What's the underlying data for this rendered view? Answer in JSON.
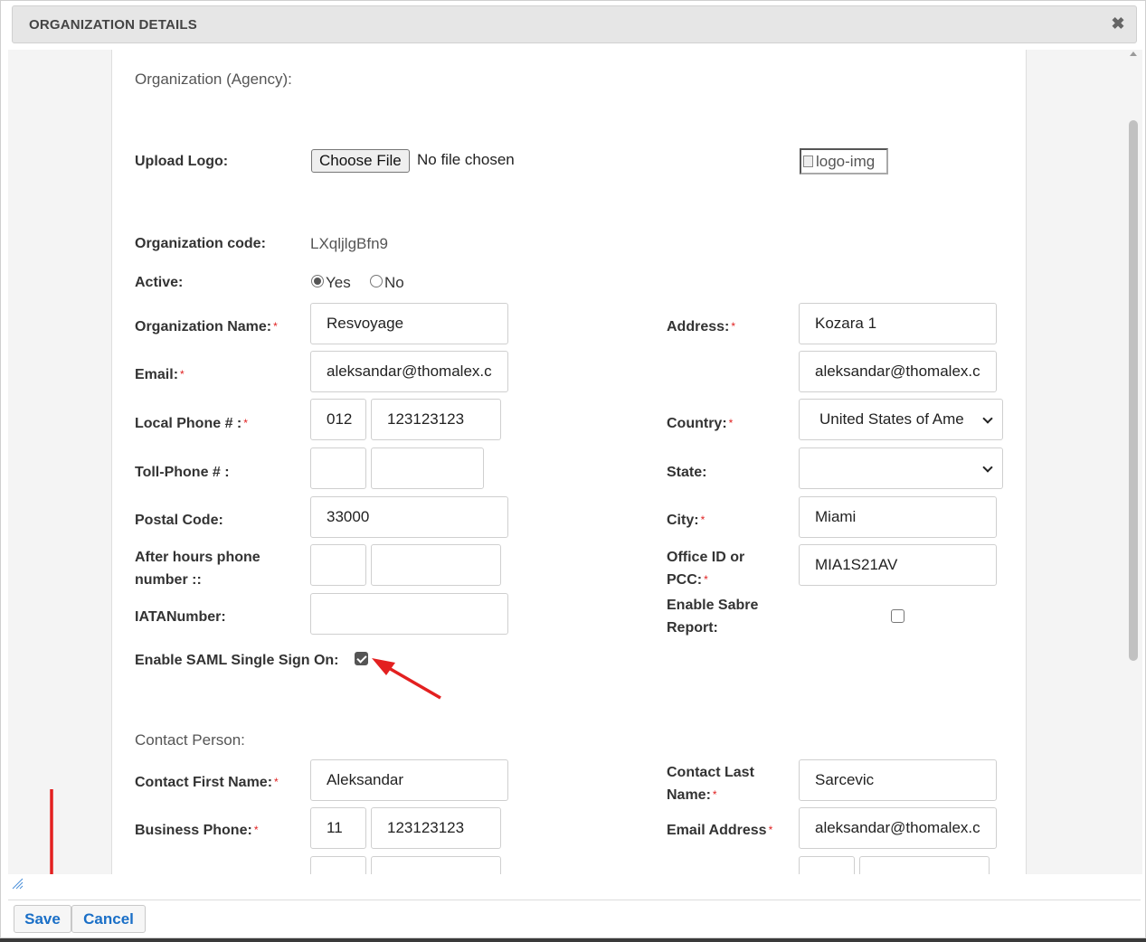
{
  "dialog": {
    "title": "ORGANIZATION DETAILS",
    "close_glyph": "✖"
  },
  "sections": {
    "organization": "Organization (Agency):",
    "contact": "Contact Person:"
  },
  "upload_logo": {
    "label": "Upload Logo:",
    "button": "Choose File",
    "status": "No file chosen",
    "logo_alt": "logo-img"
  },
  "org_code": {
    "label": "Organization code:",
    "value": "LXqljlgBfn9"
  },
  "active": {
    "label": "Active:",
    "yes": "Yes",
    "no": "No",
    "selected": "Yes"
  },
  "left_fields": {
    "org_name": {
      "label": "Organization Name:",
      "required": "*",
      "value": "Resvoyage"
    },
    "email": {
      "label": "Email:",
      "required": "*",
      "value": "aleksandar@thomalex.c"
    },
    "local_phone": {
      "label": "Local Phone # :",
      "required": "*",
      "code": "012",
      "number": "123123123"
    },
    "toll_phone": {
      "label": "Toll-Phone # :",
      "code": "",
      "number": ""
    },
    "postal_code": {
      "label": "Postal Code:",
      "value": "33000"
    },
    "after_hours": {
      "label_line1": "After hours phone",
      "label_line2": "number ::",
      "code": "",
      "number": ""
    },
    "iata": {
      "label": "IATANumber:",
      "value": ""
    },
    "saml": {
      "label": "Enable SAML Single Sign On:",
      "checked": true
    }
  },
  "right_fields": {
    "address": {
      "label": "Address:",
      "required": "*",
      "line1": "Kozara 1",
      "line2": "aleksandar@thomalex.c"
    },
    "country": {
      "label": "Country:",
      "required": "*",
      "value": "United States of Ame"
    },
    "state": {
      "label": "State:",
      "value": ""
    },
    "city": {
      "label": "City:",
      "required": "*",
      "value": "Miami"
    },
    "office_id": {
      "label_line1": "Office ID or",
      "label_line2": "PCC:",
      "required": "*",
      "value": "MIA1S21AV"
    },
    "sabre": {
      "label_line1": "Enable Sabre",
      "label_line2": "Report:",
      "checked": false
    }
  },
  "contact": {
    "first_name": {
      "label": "Contact First Name:",
      "required": "*",
      "value": "Aleksandar"
    },
    "last_name": {
      "label_line1": "Contact Last",
      "label_line2": "Name:",
      "required": "*",
      "value": "Sarcevic"
    },
    "business_phone": {
      "label": "Business Phone:",
      "required": "*",
      "code": "11",
      "number": "123123123"
    },
    "email_address": {
      "label": "Email Address",
      "required": "*",
      "value": "aleksandar@thomalex.c"
    }
  },
  "footer": {
    "save": "Save",
    "cancel": "Cancel"
  },
  "colors": {
    "accent_button_text": "#1a6fc7",
    "required_star": "#e02020",
    "annotation_arrow": "#e32020"
  },
  "icons": {
    "close": "close-icon",
    "resize": "resize-grip-icon",
    "dropdown": "chevron-down-icon"
  }
}
